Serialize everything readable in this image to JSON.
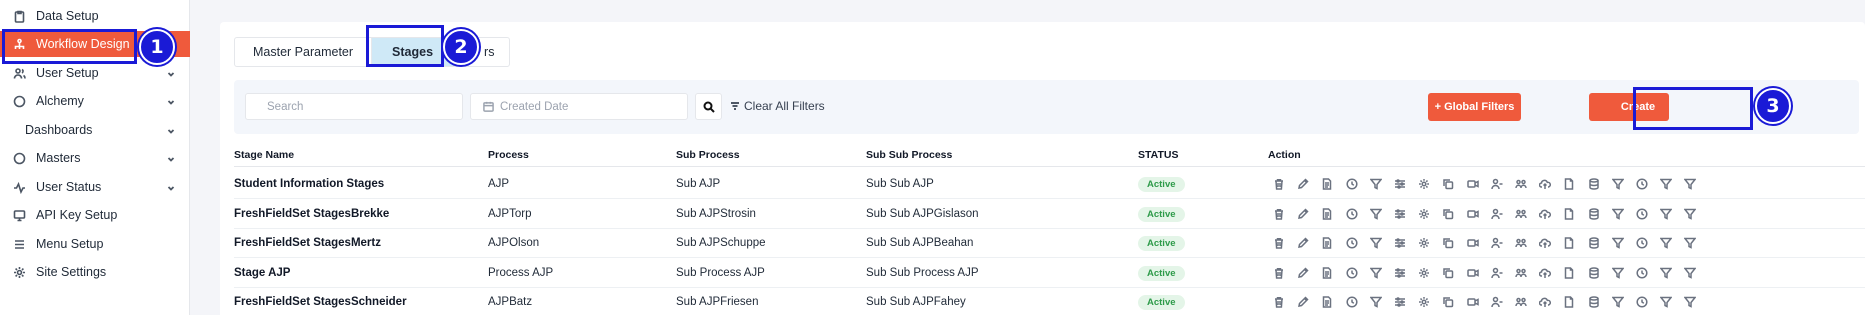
{
  "sidebar": {
    "items": [
      {
        "label": "Data Setup",
        "icon": "clipboard-icon"
      },
      {
        "label": "Workflow Design",
        "icon": "workflow-icon",
        "active": true
      },
      {
        "label": "User Setup",
        "icon": "users-icon",
        "chevron": true
      },
      {
        "label": "Alchemy",
        "icon": "circle-icon",
        "chevron": true
      },
      {
        "label": "Dashboards",
        "icon": "",
        "chevron": true
      },
      {
        "label": "Masters",
        "icon": "circle-icon",
        "chevron": true
      },
      {
        "label": "User Status",
        "icon": "activity-icon",
        "chevron": true
      },
      {
        "label": "API Key Setup",
        "icon": "monitor-icon"
      },
      {
        "label": "Menu Setup",
        "icon": "menu-icon"
      },
      {
        "label": "Site Settings",
        "icon": "gear-icon"
      }
    ]
  },
  "annotations": [
    "1",
    "2",
    "3"
  ],
  "tabs": [
    {
      "label": "Master Parameter"
    },
    {
      "label": "Stages",
      "active": true
    },
    {
      "label": "rs"
    }
  ],
  "filters": {
    "search_placeholder": "Search",
    "date_placeholder": "Created Date",
    "clear_label": "Clear All Filters",
    "global_filters_label": "+ Global Filters",
    "create_label": "Create"
  },
  "table": {
    "headers": [
      "Stage Name",
      "Process",
      "Sub Process",
      "Sub Sub Process",
      "STATUS",
      "Action"
    ],
    "rows": [
      {
        "name": "Student Information Stages",
        "process": "AJP",
        "sub": "Sub AJP",
        "subsub": "Sub Sub AJP",
        "status": "Active"
      },
      {
        "name": "FreshFieldSet StagesBrekke",
        "process": "AJPTorp",
        "sub": "Sub AJPStrosin",
        "subsub": "Sub Sub AJPGislason",
        "status": "Active"
      },
      {
        "name": "FreshFieldSet StagesMertz",
        "process": "AJPOlson",
        "sub": "Sub AJPSchuppe",
        "subsub": "Sub Sub AJPBeahan",
        "status": "Active"
      },
      {
        "name": "Stage AJP",
        "process": "Process AJP",
        "sub": "Sub Process AJP",
        "subsub": "Sub Sub Process AJP",
        "status": "Active"
      },
      {
        "name": "FreshFieldSet StagesSchneider",
        "process": "AJPBatz",
        "sub": "Sub AJPFriesen",
        "subsub": "Sub Sub AJPFahey",
        "status": "Active"
      }
    ],
    "action_icons": [
      "trash-icon",
      "edit-icon",
      "document-icon",
      "clock-icon",
      "filter-icon",
      "sliders-icon",
      "gear-icon",
      "copy-icon",
      "video-icon",
      "user-minus-icon",
      "users-group-icon",
      "cloud-upload-icon",
      "file-icon",
      "database-icon",
      "filter-icon",
      "clock-icon",
      "filter-icon",
      "filter-icon"
    ]
  },
  "colors": {
    "accent": "#ef5a3c",
    "annotation": "#1a1ad6",
    "active_tab": "#cfe9f7",
    "status_bg": "#e4f5e8",
    "status_text": "#2e9b4a"
  }
}
